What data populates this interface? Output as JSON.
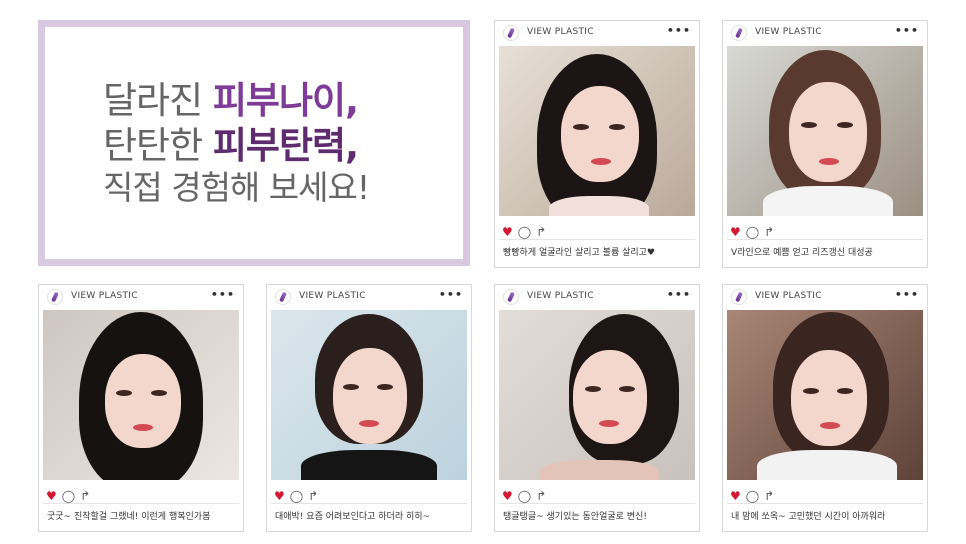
{
  "headline": {
    "line1_normal": "달라진 ",
    "line1_bold": "피부나이,",
    "line2_normal": "탄탄한 ",
    "line2_bold": "피부탄력,",
    "line3": "직접 경험해 보세요!"
  },
  "brand_label": "VIEW PLASTIC",
  "more_label": "•••",
  "colors": {
    "accent": "#7e3b97",
    "heart": "#d3182f",
    "frame": "#d8c8e0"
  },
  "posts": [
    {
      "caption": "빵빵하게 얼굴라인 살리고 볼륨 살리고♥",
      "photo": "woman-selfie-1"
    },
    {
      "caption": "V라인으로 예쁨 얻고 리즈갱신 대성공",
      "photo": "woman-selfie-2"
    },
    {
      "caption": "굿굿~ 진작할걸 그랬네! 이런게 행복인가봄",
      "photo": "woman-selfie-3"
    },
    {
      "caption": "대애박! 요즘 어려보인다고 하더라 히히~",
      "photo": "woman-selfie-4"
    },
    {
      "caption": "탱글탱글~ 생기있는 동안얼굴로 변신!",
      "photo": "woman-selfie-5"
    },
    {
      "caption": "내 맘에 쏘옥~ 고민했던 시간이 아까워라",
      "photo": "woman-selfie-6"
    }
  ]
}
